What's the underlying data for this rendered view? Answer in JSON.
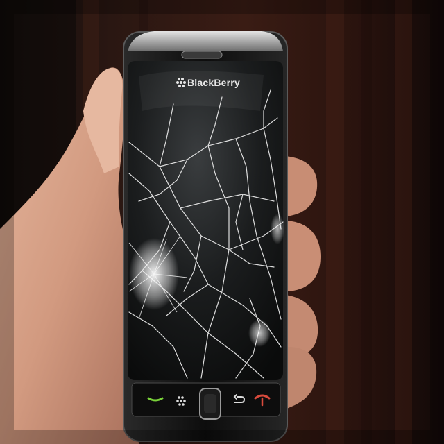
{
  "scene": {
    "description_tags": [
      "hand",
      "broken-smartphone",
      "cracked-screen"
    ],
    "phone": {
      "brand": "BlackBerry"
    },
    "colors": {
      "background": "#1a0f0c",
      "curtain": "#3a1c14",
      "skin": "#d8a58c",
      "phone_body": "#141414",
      "bezel": "#9a9a9a",
      "crack": "#f2f2f2",
      "call_key": "#7ad23a",
      "end_key": "#d84a3c"
    }
  }
}
